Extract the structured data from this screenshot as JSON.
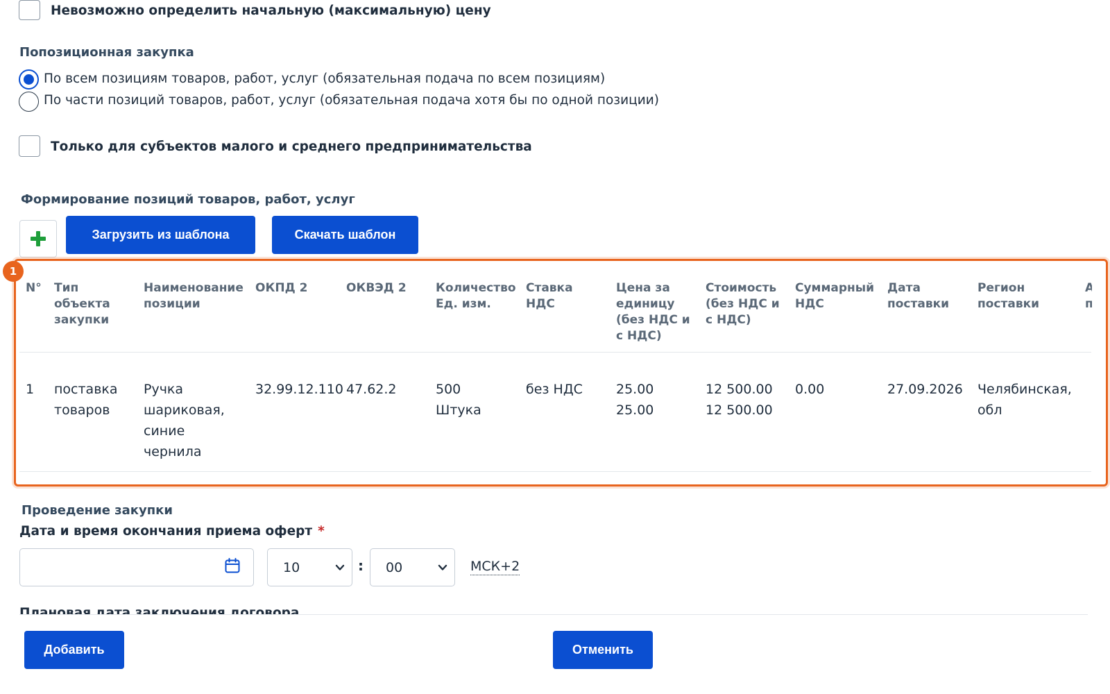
{
  "price_checkbox": {
    "label": "Невозможно определить начальную (максимальную) цену"
  },
  "positional": {
    "title": "Попозиционная закупка",
    "options": [
      {
        "label": "По всем позициям товаров, работ, услуг (обязательная подача по всем позициям)",
        "checked": true
      },
      {
        "label": "По части позиций товаров, работ, услуг (обязательная подача хотя бы по одной позиции)",
        "checked": false
      }
    ]
  },
  "sme_checkbox": {
    "label": "Только для субъектов малого и среднего предпринимательства"
  },
  "positions": {
    "title": "Формирование позиций товаров, работ, услуг",
    "load_template_label": "Загрузить из шаблона",
    "download_template_label": "Скачать шаблон",
    "badge": "1",
    "table": {
      "headers": {
        "num": "N°",
        "type": "Тип объекта закупки",
        "name": "Наименование позиции",
        "okpd": "ОКПД 2",
        "okved": "ОКВЭД 2",
        "qty": "Количество Ед. изм.",
        "vat_rate": "Ставка НДС",
        "unit_price": "Цена за единицу (без НДС и с НДС)",
        "cost": "Стоимость (без НДС и с НДС)",
        "total_vat": "Суммарный НДС",
        "delivery_date": "Дата поставки",
        "region": "Регион поставки",
        "extra": "А п"
      },
      "rows": [
        {
          "num": "1",
          "type": "поставка товаров",
          "name": "Ручка шариковая, синие чернила",
          "okpd": "32.99.12.110",
          "okved": "47.62.2",
          "qty": "500",
          "unit": "Штука",
          "vat_rate": "без НДС",
          "unit_price_no_vat": "25.00",
          "unit_price_vat": "25.00",
          "cost_no_vat": "12 500.00",
          "cost_vat": "12 500.00",
          "total_vat": "0.00",
          "delivery_date": "27.09.2026",
          "region": "Челябинская, обл"
        }
      ]
    }
  },
  "conduct": {
    "title": "Проведение закупки",
    "deadline_label": "Дата и время окончания приема оферт",
    "required_mark": "*",
    "date_value": "",
    "hour_value": "10",
    "minute_value": "00",
    "separator": ":",
    "timezone": "МСК+2",
    "next_label": "Плановая дата заключения договора"
  },
  "footer": {
    "add_label": "Добавить",
    "cancel_label": "Отменить"
  }
}
